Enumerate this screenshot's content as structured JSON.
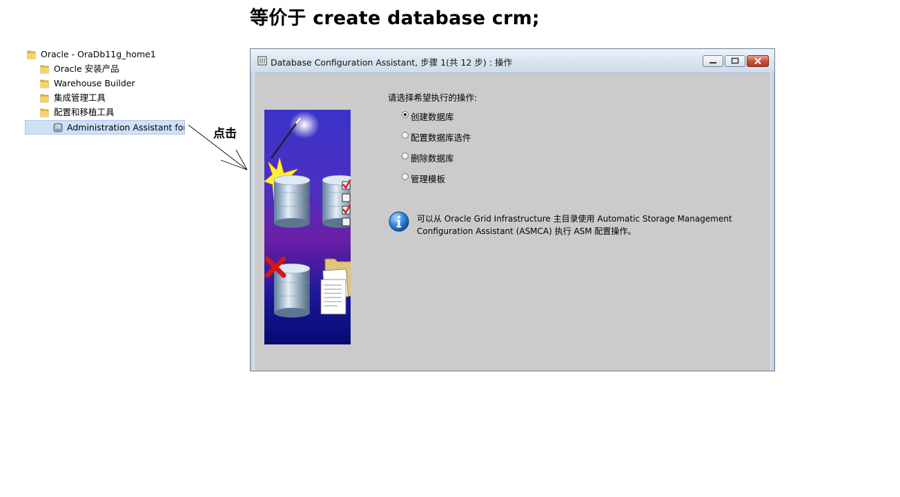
{
  "heading": "等价于  create database crm;",
  "annotation": "点击",
  "tree": {
    "root": "Oracle - OraDb11g_home1",
    "items": [
      "Oracle 安装产品",
      "Warehouse Builder",
      "集成管理工具",
      "配置和移植工具"
    ],
    "selected": "Administration Assistant for W"
  },
  "window": {
    "title": "Database Configuration Assistant, 步骤 1(共 12 步) : 操作",
    "prompt": "请选择希望执行的操作:",
    "options": [
      {
        "label": "创建数据库",
        "checked": true
      },
      {
        "label": "配置数据库选件",
        "checked": false
      },
      {
        "label": "删除数据库",
        "checked": false
      },
      {
        "label": "管理模板",
        "checked": false
      }
    ],
    "info": "可以从 Oracle Grid Infrastructure 主目录使用 Automatic Storage Management Configuration Assistant (ASMCA) 执行 ASM 配置操作。"
  }
}
